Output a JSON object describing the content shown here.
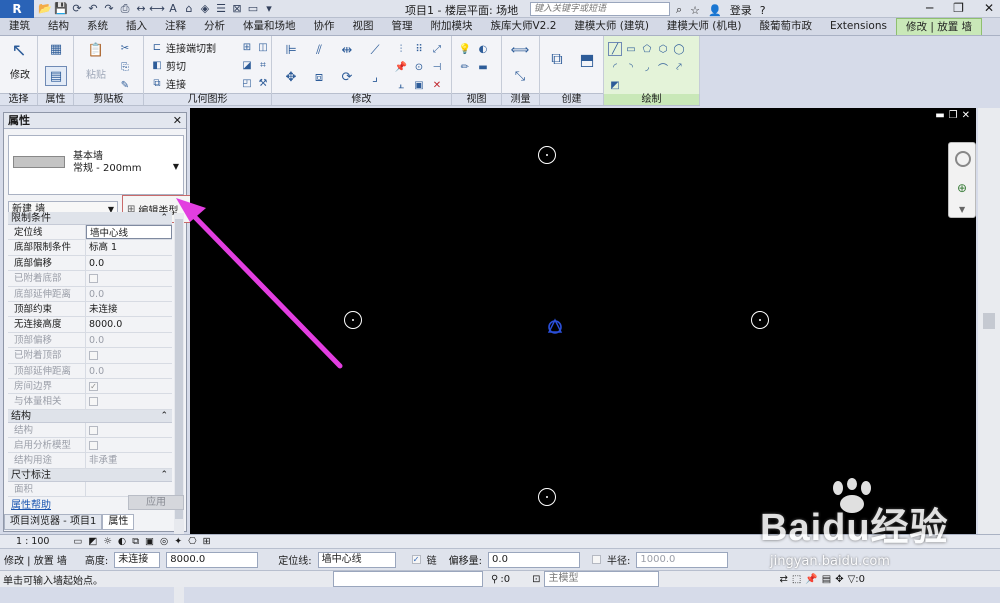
{
  "window": {
    "title": "项目1 - 楼层平面: 场地",
    "search_placeholder": "键入关键字或短语",
    "login_label": "登录"
  },
  "tabs": [
    "建筑",
    "结构",
    "系统",
    "插入",
    "注释",
    "分析",
    "体量和场地",
    "协作",
    "视图",
    "管理",
    "附加模块",
    "族库大师V2.2",
    "建模大师 (建筑)",
    "建模大师 (机电)",
    "酸葡萄市政",
    "Extensions",
    "修改 | 放置 墙"
  ],
  "ribbon": {
    "modify_label": "修改",
    "paste_label": "粘贴",
    "connect_cut_label": "连接端切割",
    "cut_label": "剪切",
    "join_label": "连接",
    "panels": [
      "选择",
      "属性",
      "剪贴板",
      "几何图形",
      "修改",
      "视图",
      "测量",
      "创建",
      "绘制"
    ]
  },
  "properties": {
    "title": "属性",
    "type_family": "基本墙",
    "type_name": "常规 - 200mm",
    "instance_selector": "新建 墙",
    "edit_type_label": "编辑类型",
    "groups": [
      {
        "name": "限制条件",
        "rows": [
          {
            "key": "定位线",
            "value": "墙中心线",
            "disabled": false,
            "boxed": true
          },
          {
            "key": "底部限制条件",
            "value": "标高 1",
            "disabled": false
          },
          {
            "key": "底部偏移",
            "value": "0.0",
            "disabled": false
          },
          {
            "key": "已附着底部",
            "value": "",
            "disabled": true,
            "checkbox": true
          },
          {
            "key": "底部延伸距离",
            "value": "0.0",
            "disabled": true
          },
          {
            "key": "顶部约束",
            "value": "未连接",
            "disabled": false
          },
          {
            "key": "无连接高度",
            "value": "8000.0",
            "disabled": false
          },
          {
            "key": "顶部偏移",
            "value": "0.0",
            "disabled": true
          },
          {
            "key": "已附着顶部",
            "value": "",
            "disabled": true,
            "checkbox": true
          },
          {
            "key": "顶部延伸距离",
            "value": "0.0",
            "disabled": true
          },
          {
            "key": "房间边界",
            "value": "✓",
            "disabled": true,
            "checkbox": true
          },
          {
            "key": "与体量相关",
            "value": "",
            "disabled": true,
            "checkbox": true
          }
        ]
      },
      {
        "name": "结构",
        "rows": [
          {
            "key": "结构",
            "value": "",
            "disabled": true,
            "checkbox": true
          },
          {
            "key": "启用分析模型",
            "value": "",
            "disabled": true,
            "checkbox": true
          },
          {
            "key": "结构用途",
            "value": "非承重",
            "disabled": true
          }
        ]
      },
      {
        "name": "尺寸标注",
        "rows": [
          {
            "key": "面积",
            "value": "",
            "disabled": true
          }
        ]
      }
    ],
    "help_link": "属性帮助",
    "apply_label": "应用",
    "bottom_tabs": [
      "项目浏览器 - 项目1",
      "属性"
    ]
  },
  "view_control": {
    "scale": "1 : 100"
  },
  "options_bar": {
    "context": "修改 | 放置 墙",
    "height_label": "高度:",
    "height_mode": "未连接",
    "height_value": "8000.0",
    "location_label": "定位线:",
    "location_value": "墙中心线",
    "chain_label": "链",
    "offset_label": "偏移量:",
    "offset_value": "0.0",
    "radius_label": "半径:",
    "radius_value": "1000.0"
  },
  "status": {
    "message": "单击可输入墙起始点。",
    "coord": ":0",
    "model": "主模型",
    "filter_count": ":0"
  },
  "watermark": {
    "brand": "Baidu经验",
    "url": "jingyan.baidu.com"
  },
  "colors": {
    "accent_green": "#c9e8b8",
    "annotation_arrow": "#e23ee0",
    "canvas_bg": "#000000"
  }
}
